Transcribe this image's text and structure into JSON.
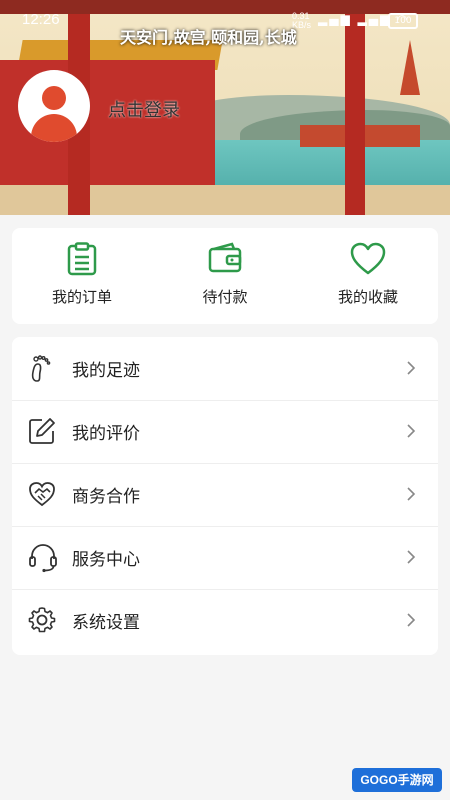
{
  "status_bar": {
    "time": "12:26",
    "net_speed": "0.31",
    "net_unit": "KB/s",
    "battery": "100"
  },
  "banner": {
    "caption": "天安门,故宫,颐和园,长城"
  },
  "profile": {
    "login_label": "点击登录"
  },
  "quick_actions": [
    {
      "label": "我的订单",
      "icon": "clipboard-icon"
    },
    {
      "label": "待付款",
      "icon": "wallet-icon"
    },
    {
      "label": "我的收藏",
      "icon": "heart-icon"
    }
  ],
  "menu": [
    {
      "label": "我的足迹",
      "icon": "footprint-icon"
    },
    {
      "label": "我的评价",
      "icon": "edit-icon"
    },
    {
      "label": "商务合作",
      "icon": "handshake-icon"
    },
    {
      "label": "服务中心",
      "icon": "headset-icon"
    },
    {
      "label": "系统设置",
      "icon": "gear-icon"
    }
  ],
  "watermark": "GOGO手游网",
  "colors": {
    "accent": "#2e9a4a",
    "avatar": "#e04b2e"
  }
}
